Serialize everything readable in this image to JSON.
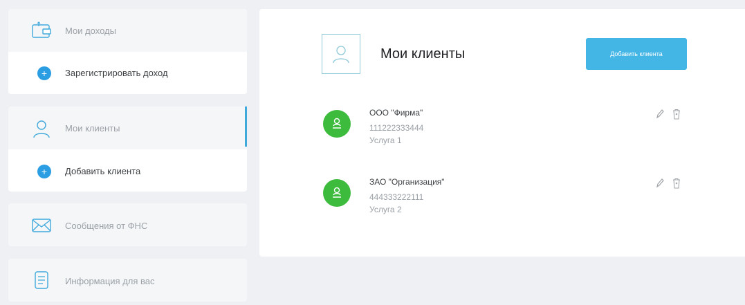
{
  "sidebar": {
    "income": {
      "title": "Мои доходы",
      "register_label": "Зарегистрировать доход"
    },
    "clients": {
      "title": "Мои клиенты",
      "add_label": "Добавить клиента"
    },
    "messages": {
      "title": "Сообщения от ФНС"
    },
    "info": {
      "title": "Информация для вас"
    }
  },
  "main": {
    "title": "Мои клиенты",
    "add_button_label": "Добавить клиента",
    "clients": [
      {
        "name": "ООО \"Фирма\"",
        "inn": "111222333444",
        "service": "Услуга 1"
      },
      {
        "name": "ЗАО \"Организация\"",
        "inn": "444333222111",
        "service": "Услуга 2"
      }
    ]
  },
  "icons": {
    "income": "wallet-icon",
    "register": "plus-icon",
    "clients": "user-icon",
    "add_client": "plus-icon",
    "messages": "envelope-icon",
    "info": "document-icon",
    "edit": "pencil-icon",
    "delete": "trash-icon"
  },
  "colors": {
    "accent": "#44b6e6",
    "plus": "#2b9ee3",
    "active_indicator": "#3fa9dc",
    "client_avatar": "#3dbb3d",
    "background": "#eef0f4"
  }
}
